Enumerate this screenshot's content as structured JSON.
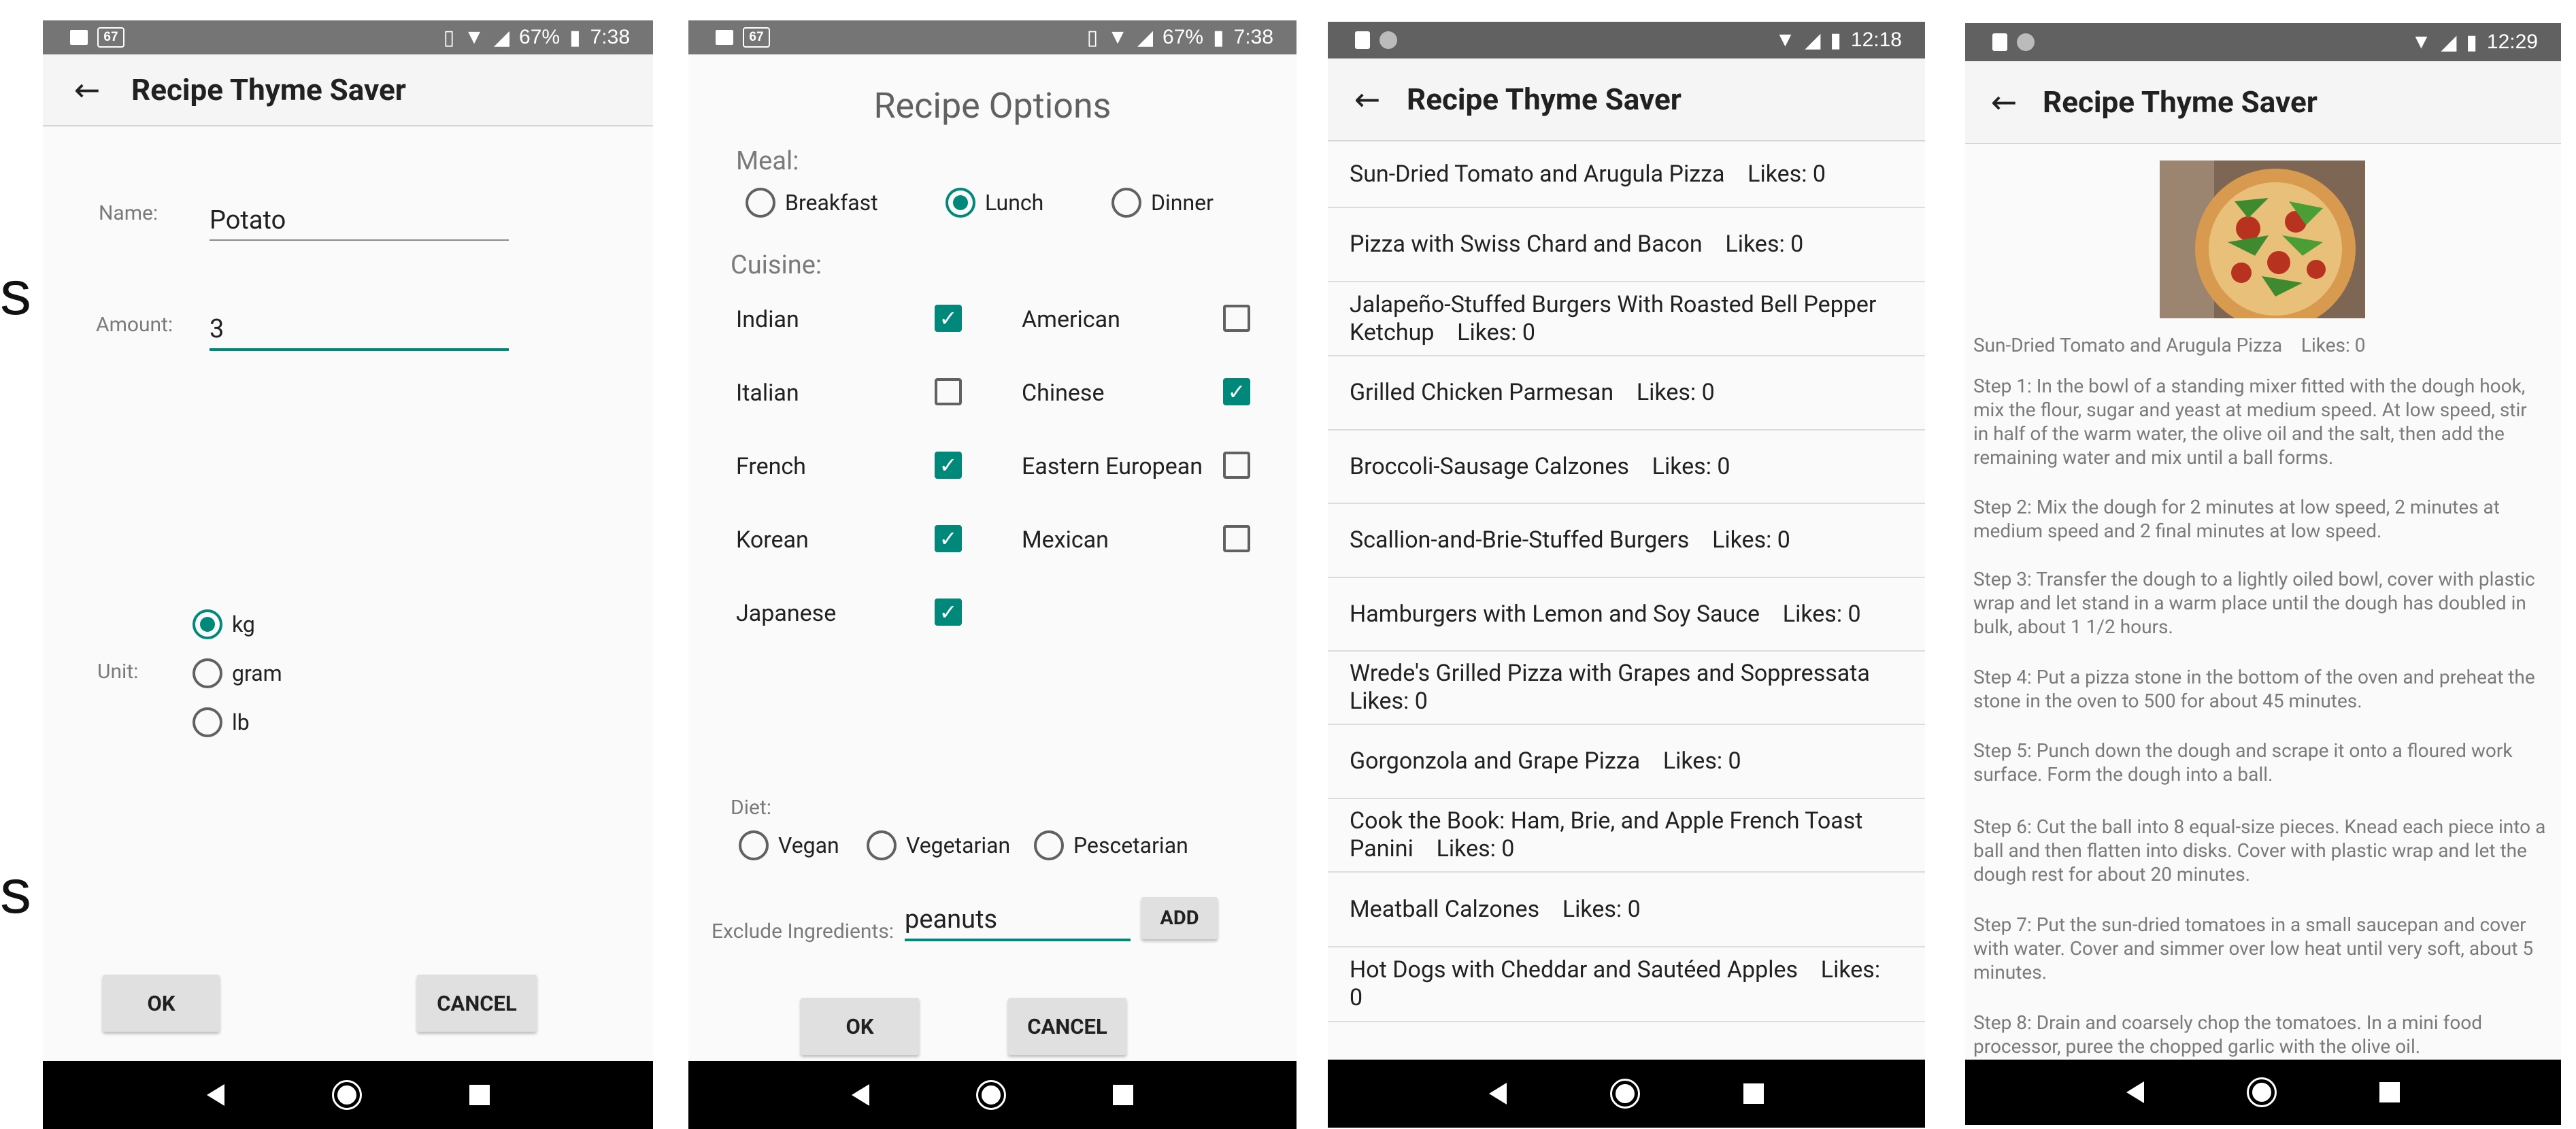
{
  "edge_glyphs": [
    "s",
    "s"
  ],
  "status_bars": [
    {
      "badge": "67",
      "battery": "67%",
      "time": "7:38"
    },
    {
      "badge": "67",
      "battery": "67%",
      "time": "7:38"
    },
    {
      "time": "12:18"
    },
    {
      "time": "12:29"
    }
  ],
  "app_title": "Recipe Thyme Saver",
  "ingredient_screen": {
    "name_label": "Name:",
    "name_value": "Potato",
    "amount_label": "Amount:",
    "amount_value": "3",
    "unit_label": "Unit:",
    "units": [
      "kg",
      "gram",
      "lb"
    ],
    "selected_unit": "kg",
    "ok_label": "OK",
    "cancel_label": "CANCEL"
  },
  "options_screen": {
    "title": "Recipe Options",
    "meal_label": "Meal:",
    "meals": [
      "Breakfast",
      "Lunch",
      "Dinner"
    ],
    "selected_meal": "Lunch",
    "cuisine_label": "Cuisine:",
    "cuisines": [
      {
        "name": "Indian",
        "checked": true
      },
      {
        "name": "American",
        "checked": false
      },
      {
        "name": "Italian",
        "checked": false
      },
      {
        "name": "Chinese",
        "checked": true
      },
      {
        "name": "French",
        "checked": true
      },
      {
        "name": "Eastern European",
        "checked": false
      },
      {
        "name": "Korean",
        "checked": true
      },
      {
        "name": "Mexican",
        "checked": false
      },
      {
        "name": "Japanese",
        "checked": true
      }
    ],
    "diet_label": "Diet:",
    "diets": [
      "Vegan",
      "Vegetarian",
      "Pescetarian"
    ],
    "exclude_label": "Exclude Ingredients:",
    "exclude_value": "peanuts",
    "add_label": "ADD",
    "ok_label": "OK",
    "cancel_label": "CANCEL"
  },
  "recipe_list": [
    "Sun-Dried Tomato and Arugula Pizza    Likes: 0",
    "Pizza with Swiss Chard and Bacon    Likes: 0",
    "Jalapeño-Stuffed Burgers With Roasted Bell Pepper Ketchup    Likes: 0",
    "Grilled Chicken Parmesan    Likes: 0",
    "Broccoli-Sausage Calzones    Likes: 0",
    "Scallion-and-Brie-Stuffed Burgers    Likes: 0",
    "Hamburgers with Lemon and Soy Sauce    Likes: 0",
    "Wrede's Grilled Pizza with Grapes and Soppressata Likes: 0",
    "Gorgonzola and Grape Pizza    Likes: 0",
    "Cook the Book: Ham, Brie, and Apple French Toast Panini    Likes: 0",
    "Meatball Calzones    Likes: 0",
    "Hot Dogs with Cheddar and Sautéed Apples    Likes: 0"
  ],
  "recipe_detail": {
    "header": "Sun-Dried Tomato and Arugula Pizza    Likes: 0",
    "steps": [
      "Step 1: In the bowl of a standing mixer fitted with the dough hook, mix the flour, sugar and yeast at medium speed. At low speed, stir in half of the warm water, the olive oil and the salt, then add the remaining water and mix until a ball forms.",
      "Step 2: Mix the dough for 2 minutes at low speed, 2 minutes at medium speed and 2 final minutes at low speed.",
      "Step 3: Transfer the dough to a lightly oiled bowl, cover with plastic wrap and let stand in a warm place until the dough has doubled in bulk, about 1 1/2 hours.",
      "Step 4: Put a pizza stone in the bottom of the oven and preheat the stone in the oven to 500 for about 45 minutes.",
      "Step 5: Punch down the dough and scrape it onto a floured work surface. Form the dough into a ball.",
      "Step 6: Cut the ball into 8 equal-size pieces. Knead each piece into a ball and then flatten into disks. Cover with plastic wrap and let the dough rest for about 20 minutes.",
      "Step 7: Put the sun-dried tomatoes in a small saucepan and cover with water. Cover and simmer over low heat until very soft, about 5 minutes.",
      "Step 8: Drain and coarsely chop the tomatoes. In a mini food processor, puree the chopped garlic with the olive oil."
    ]
  },
  "colors": {
    "accent": "#00897b",
    "statusbar_1": "#757575",
    "statusbar_2": "#616161"
  }
}
